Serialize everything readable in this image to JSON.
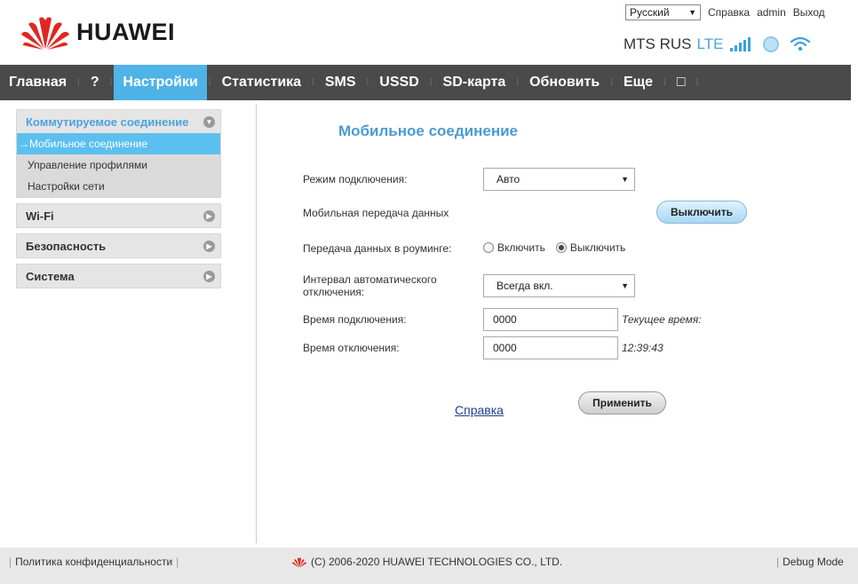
{
  "header": {
    "brand": "HUAWEI",
    "language": "Русский",
    "links": [
      "Справка",
      "admin",
      "Выход"
    ],
    "operator": "MTS RUS",
    "network_type": "LTE"
  },
  "nav": [
    {
      "label": "Главная",
      "active": false
    },
    {
      "label": "?",
      "active": false
    },
    {
      "label": "Настройки",
      "active": true
    },
    {
      "label": "Статистика",
      "active": false
    },
    {
      "label": "SMS",
      "active": false
    },
    {
      "label": "USSD",
      "active": false
    },
    {
      "label": "SD-карта",
      "active": false
    },
    {
      "label": "Обновить",
      "active": false
    },
    {
      "label": "Еще",
      "active": false
    },
    {
      "label": "□",
      "active": false
    }
  ],
  "sidebar": {
    "groups": [
      {
        "label": "Коммутируемое соединение",
        "items": [
          "→Мобильное соединение",
          "Управление профилями",
          "Настройки сети"
        ]
      },
      {
        "label": "Wi-Fi"
      },
      {
        "label": "Безопасность"
      },
      {
        "label": "Система"
      }
    ]
  },
  "main": {
    "title": "Мобильное соединение",
    "connection_mode_label": "Режим подключения:",
    "connection_mode_value": "Авто",
    "mobile_data_label": "Мобильная передача данных",
    "mobile_data_button": "Выключить",
    "roaming_label": "Передача данных в роуминге:",
    "roaming_on": "Включить",
    "roaming_off": "Выключить",
    "auto_disconnect_label_1": "Интервал автоматического",
    "auto_disconnect_label_2": "отключения:",
    "auto_disconnect_value": "Всегда вкл.",
    "connect_time_label": "Время подключения:",
    "connect_time_value": "0000",
    "current_time_label": "Текущее время:",
    "disconnect_time_label": "Время отключения:",
    "disconnect_time_value": "0000",
    "current_time_value": "12:39:43",
    "help_link": "Справка",
    "apply_button": "Применить"
  },
  "footer": {
    "privacy": "Политика конфиденциальности",
    "copyright": "(C) 2006-2020 HUAWEI TECHNOLOGIES CO., LTD.",
    "debug": "Debug Mode"
  },
  "colors": {
    "nav_bg": "#4a4a4a",
    "nav_active": "#4fb3e8",
    "accent_blue": "#4a9bd1",
    "huawei_red": "#e0271f"
  }
}
